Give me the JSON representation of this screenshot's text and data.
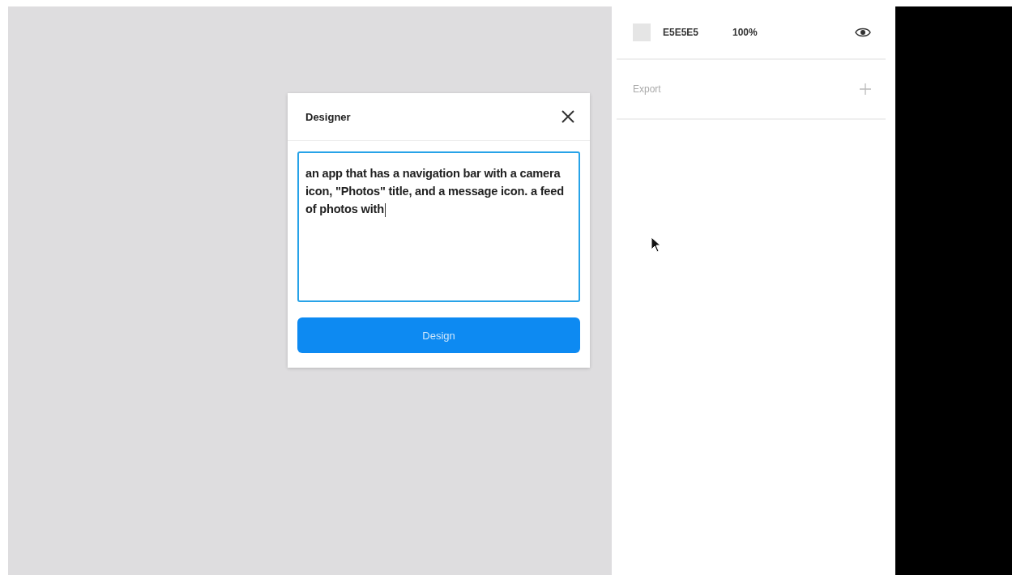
{
  "dialog": {
    "title": "Designer",
    "prompt": "an app that has a navigation bar with a camera icon, \"Photos\" title, and a message icon. a feed of photos with",
    "button": "Design"
  },
  "panel": {
    "fill": {
      "color": "#e5e5e5",
      "hex": "E5E5E5",
      "opacity": "100%"
    },
    "export": {
      "label": "Export"
    }
  }
}
